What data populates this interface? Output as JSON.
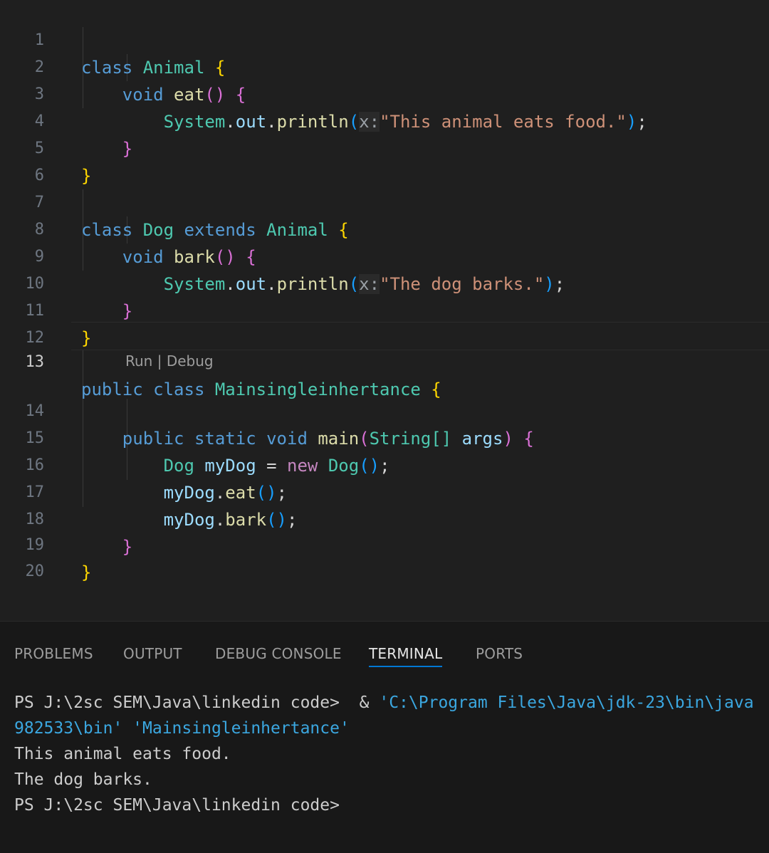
{
  "editor": {
    "line_numbers": [
      "1",
      "2",
      "3",
      "4",
      "5",
      "6",
      "7",
      "8",
      "9",
      "10",
      "11",
      "12",
      "13",
      "14",
      "15",
      "16",
      "17",
      "18",
      "19",
      "20"
    ],
    "active_line": "13",
    "codelens": {
      "run": "Run",
      "separator": " | ",
      "debug": "Debug"
    },
    "code": {
      "l1": {
        "kw": "class",
        "name": "Animal",
        "brace": "{"
      },
      "l2": {
        "ret": "void",
        "method": "eat",
        "parens": "()",
        "brace": "{"
      },
      "l3": {
        "cls": "System",
        "field": "out",
        "method": "println",
        "hint": "x:",
        "str": "\"This animal eats food.\""
      },
      "l4": {
        "brace": "}"
      },
      "l5": {
        "brace": "}"
      },
      "l7": {
        "kw": "class",
        "name": "Dog",
        "ext": "extends",
        "parent": "Animal",
        "brace": "{"
      },
      "l8": {
        "ret": "void",
        "method": "bark",
        "parens": "()",
        "brace": "{"
      },
      "l9": {
        "cls": "System",
        "field": "out",
        "method": "println",
        "hint": "x:",
        "str": "\"The dog barks.\""
      },
      "l10": {
        "brace": "}"
      },
      "l11": {
        "brace": "}"
      },
      "l13": {
        "mod": "public",
        "kw": "class",
        "name": "Mainsingleinhertance",
        "brace": "{"
      },
      "l14": {
        "mod1": "public",
        "mod2": "static",
        "ret": "void",
        "method": "main",
        "ptype": "String[]",
        "param": "args",
        "brace": "{"
      },
      "l15": {
        "type": "Dog",
        "var": "myDog",
        "op": "=",
        "new": "new",
        "ctor": "Dog"
      },
      "l16": {
        "var": "myDog",
        "method": "eat"
      },
      "l17": {
        "var": "myDog",
        "method": "bark"
      },
      "l18": {
        "brace": "}"
      },
      "l19": {
        "brace": "}"
      }
    }
  },
  "panel": {
    "tabs": [
      "PROBLEMS",
      "OUTPUT",
      "DEBUG CONSOLE",
      "TERMINAL",
      "PORTS"
    ],
    "active_tab": "TERMINAL",
    "terminal": {
      "line1_prompt": "PS J:\\2sc SEM\\Java\\linkedin code>  & ",
      "line1_cmd": "'C:\\Program Files\\Java\\jdk-23\\bin\\java",
      "line2": "982533\\bin' 'Mainsingleinhertance'",
      "line3": "This animal eats food.",
      "line4": "The dog barks.",
      "line5": "PS J:\\2sc SEM\\Java\\linkedin code>"
    }
  }
}
